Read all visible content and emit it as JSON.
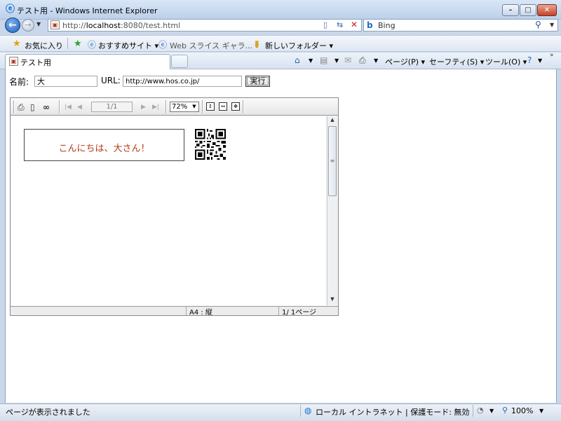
{
  "window": {
    "title": "テスト用 - Windows Internet Explorer",
    "minimize": "–",
    "maximize": "□",
    "close": "✕"
  },
  "address_bar": {
    "url_prefix": "http://",
    "url_host": "localhost",
    "url_rest": ":8080/test.html",
    "search_engine": "Bing"
  },
  "favorites_bar": {
    "favorites_label": "お気に入り",
    "links": [
      {
        "label": "おすすめサイト ▾",
        "icon": "ie-icon"
      },
      {
        "label": "Web スライス ギャラ... ▾",
        "icon": "web-slice-icon"
      },
      {
        "label": "新しいフォルダー ▾",
        "icon": "folder-icon"
      }
    ]
  },
  "tabs": [
    {
      "label": "テスト用",
      "active": true
    }
  ],
  "command_bar": {
    "page": "ページ(P) ▾",
    "safety": "セーフティ(S) ▾",
    "tools": "ツール(O) ▾"
  },
  "form": {
    "name_label": "名前:",
    "name_value": "大",
    "url_label": "URL:",
    "url_value": "http://www.hos.co.jp/",
    "run_button": "実行"
  },
  "viewer": {
    "page_indicator": "1/1",
    "zoom": "72%",
    "report_greeting": "こんにちは、大さん！",
    "paper": "A4 : 縦",
    "pages": "1/ 1ページ"
  },
  "status_bar": {
    "message": "ページが表示されました",
    "zone": "ローカル イントラネット | 保護モード: 無効",
    "zoom": "100%"
  },
  "colors": {
    "greeting_text": "#b23c1a",
    "chrome_blue": "#c9d7ea"
  }
}
